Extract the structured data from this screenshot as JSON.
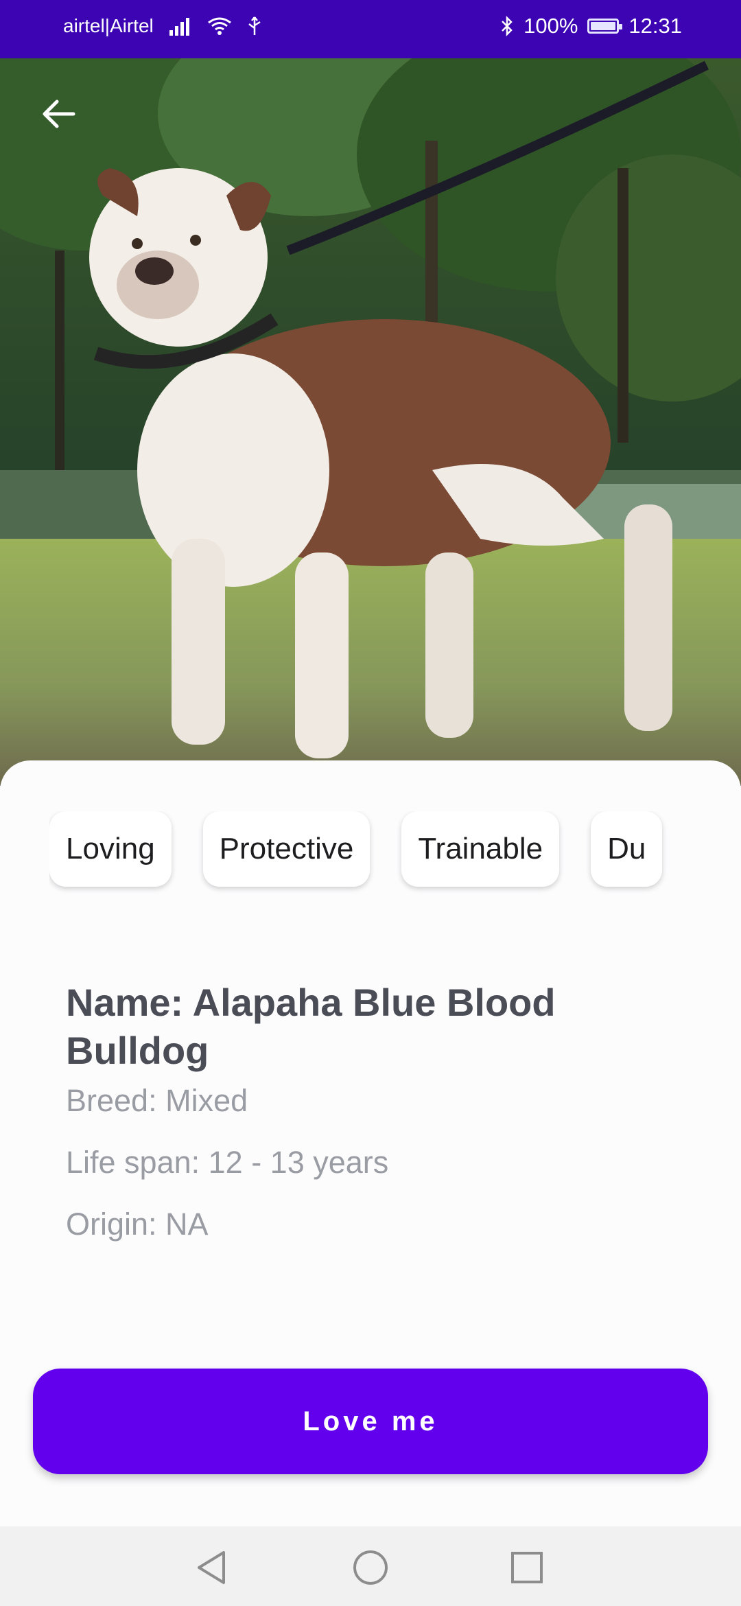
{
  "status_bar": {
    "carrier": "airtel|Airtel",
    "battery": "100%",
    "battery_level": 1.0,
    "time": "12:31"
  },
  "hero": {
    "image_icon": "dog-photo",
    "back_icon": "arrow-left-icon"
  },
  "temperament_chips": [
    "Loving",
    "Protective",
    "Trainable",
    "Du"
  ],
  "details": {
    "name": "Name: Alapaha Blue Blood Bulldog",
    "breed": "Breed: Mixed",
    "life_span": "Life span: 12 - 13 years",
    "origin": "Origin: NA"
  },
  "cta": {
    "label": "Love me",
    "color": "#6200ee"
  },
  "nav_bar": {
    "back_icon": "triangle-back-icon",
    "home_icon": "circle-home-icon",
    "recents_icon": "square-recents-icon"
  },
  "colors": {
    "status_bar": "#3d04b4",
    "title": "#4a4c56",
    "info": "#9a9ca4"
  }
}
